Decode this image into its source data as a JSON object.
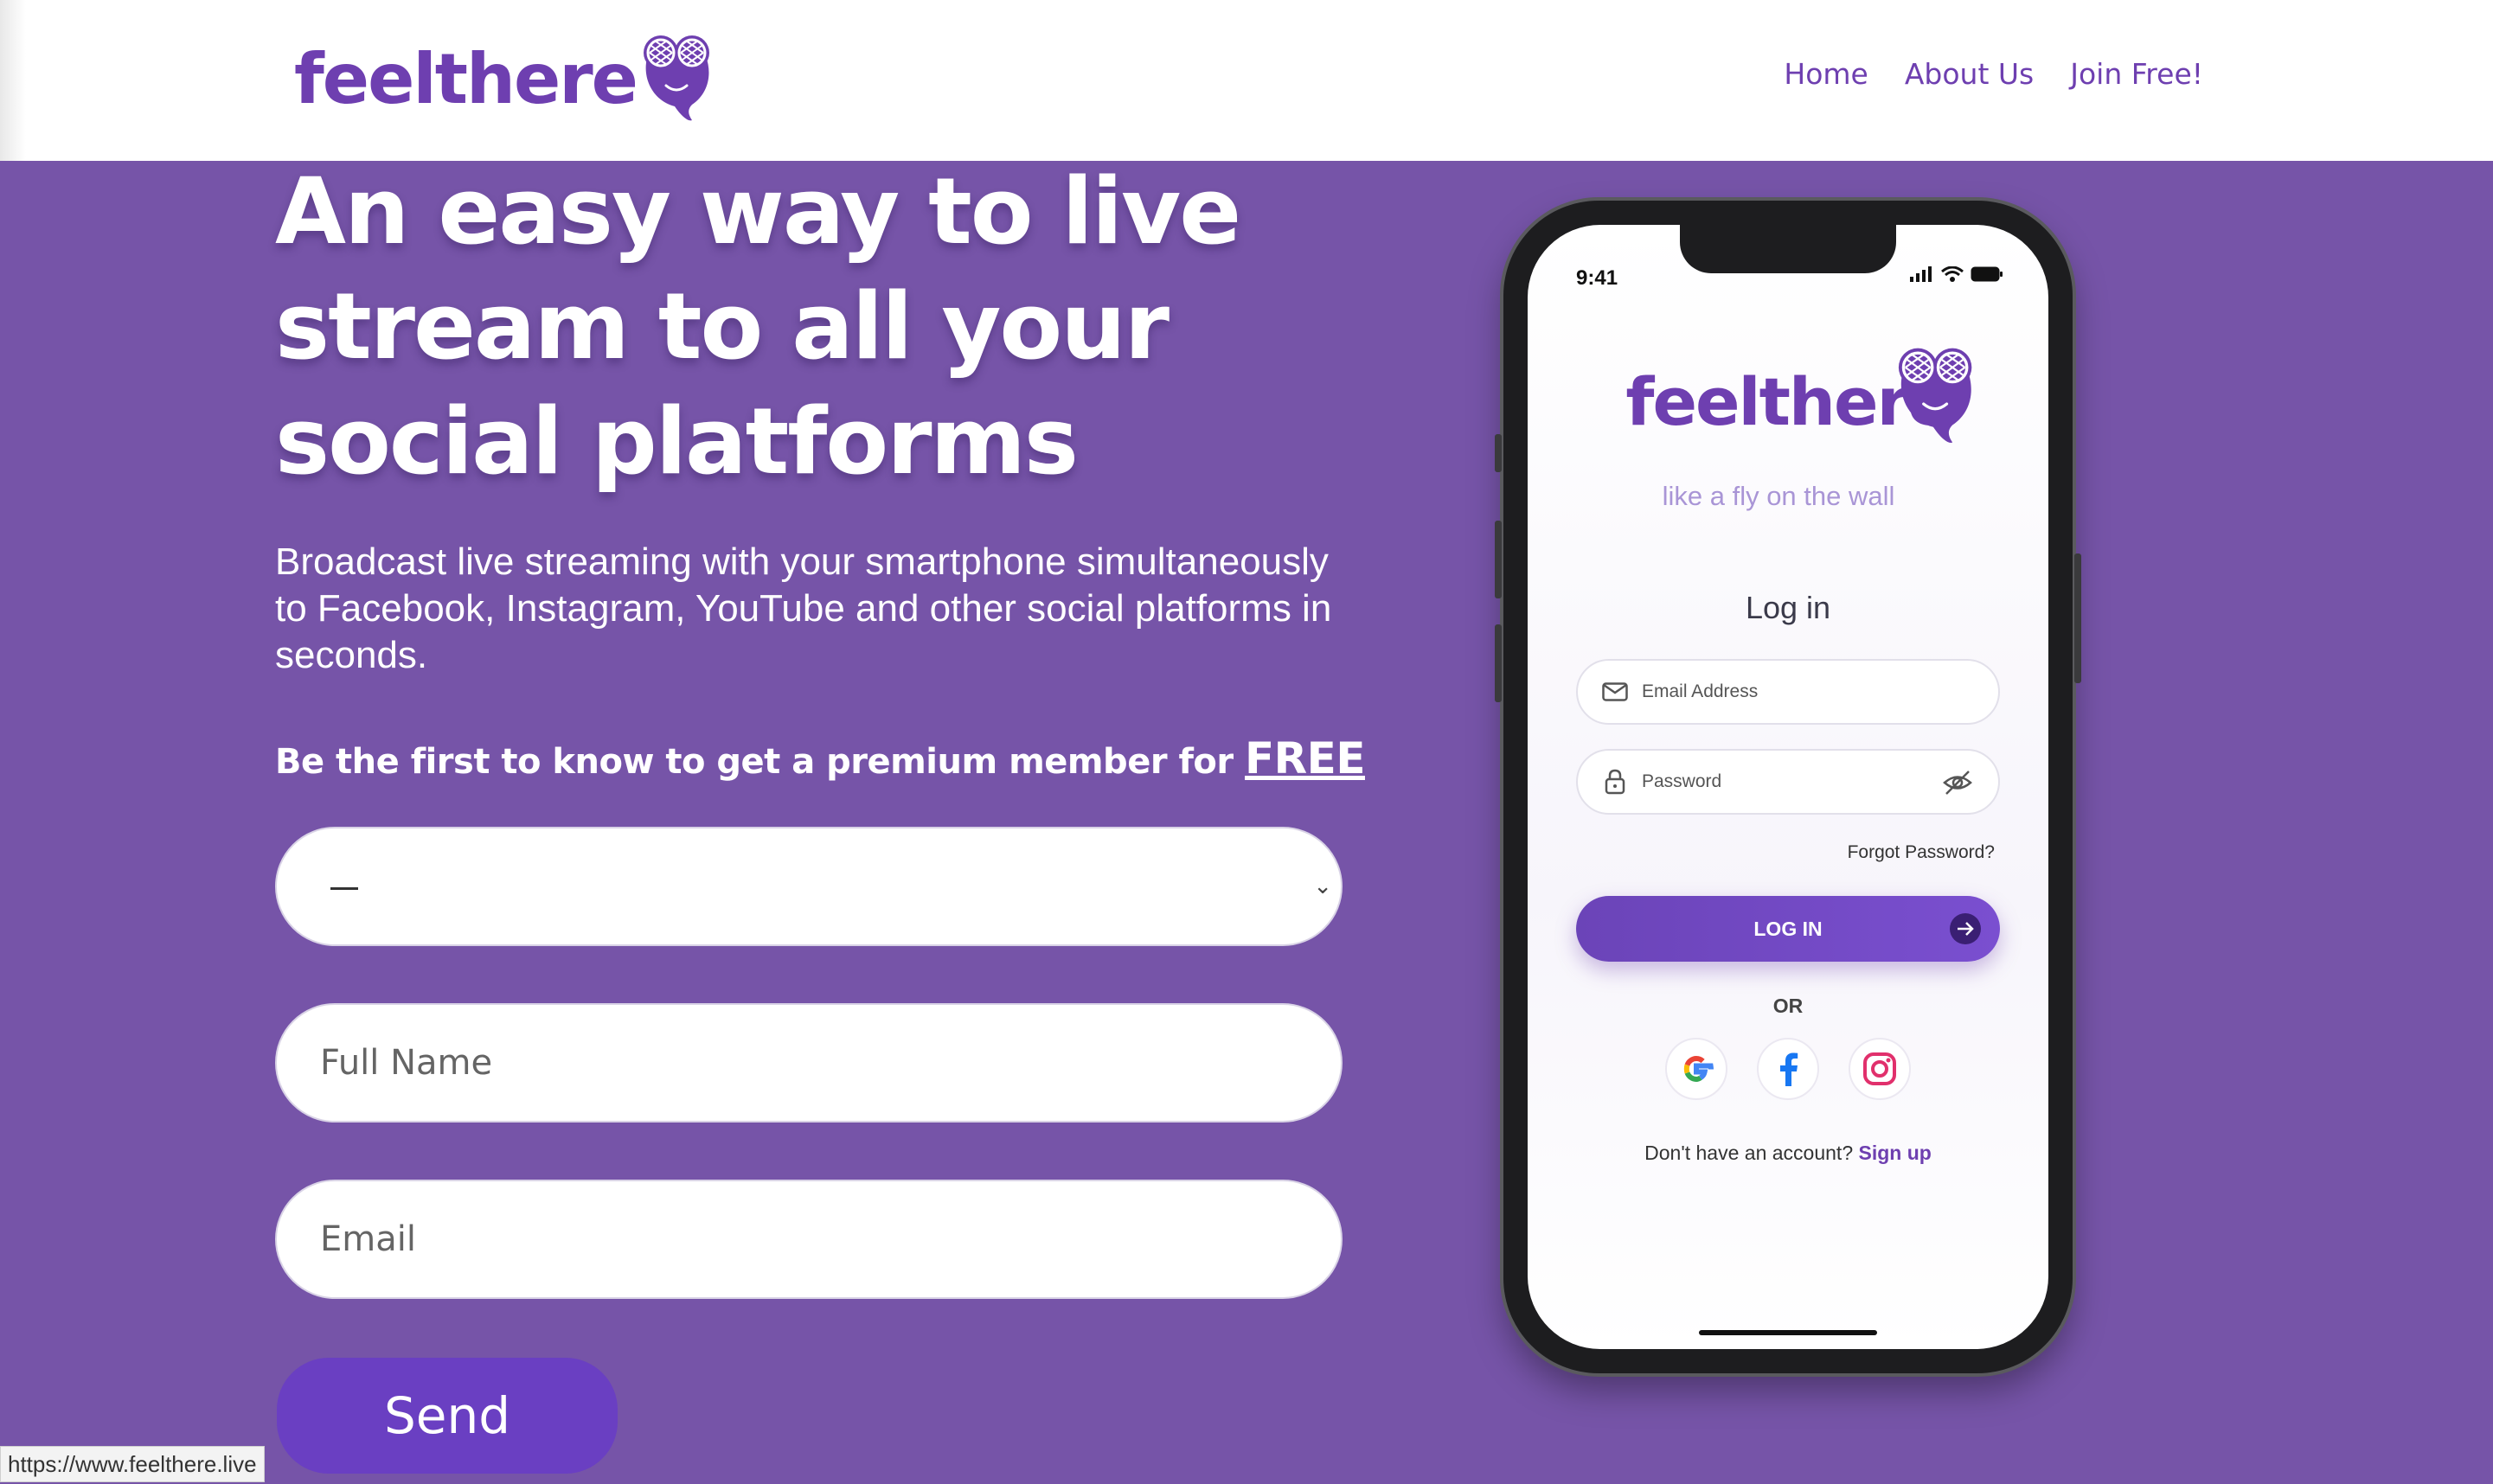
{
  "brand": {
    "name": "feelthere",
    "accent": "#6e3fb0",
    "background": "#7654a8"
  },
  "nav": {
    "home": "Home",
    "about": "About Us",
    "join": "Join Free!"
  },
  "hero": {
    "title": "An easy way to live stream to all your social platforms",
    "subtitle": "Broadcast live streaming with your smartphone simultaneously to Facebook, Instagram, YouTube and other social platforms in seconds.",
    "promo_text": "Be the first to know to get a premium member for ",
    "promo_free": "FREE"
  },
  "form": {
    "select_value": "—",
    "full_name_placeholder": "Full Name",
    "email_placeholder": "Email",
    "send_label": "Send"
  },
  "status_url": "https://www.feelthere.live",
  "phone": {
    "time": "9:41",
    "app_name": "feelthere",
    "tagline": "like a fly on the wall",
    "title": "Log in",
    "email_placeholder": "Email Address",
    "password_placeholder": "Password",
    "forgot": "Forgot Password?",
    "login_label": "LOG IN",
    "or": "OR",
    "signup_text": "Don't have an account?",
    "signup_link": "Sign up",
    "social": [
      "google-icon",
      "facebook-icon",
      "instagram-icon"
    ]
  }
}
